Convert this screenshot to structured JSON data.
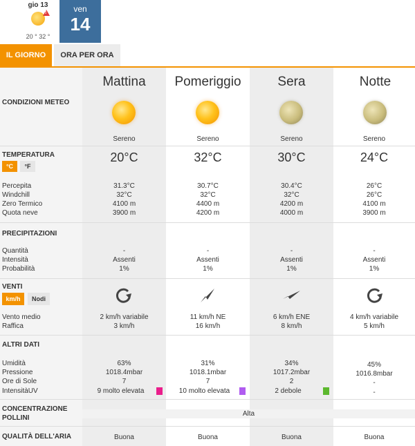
{
  "days": {
    "prev": {
      "label": "gio 13",
      "temps": "20 ° 32 °",
      "icon": "sun-warning-icon"
    },
    "selected": {
      "label": "ven",
      "number": "14"
    }
  },
  "tabs": {
    "day": "IL GIORNO",
    "hourly": "ORA PER ORA"
  },
  "periods": [
    "Mattina",
    "Pomeriggio",
    "Sera",
    "Notte"
  ],
  "sections": {
    "conditions": "CONDIZIONI METEO",
    "temperature": "TEMPERATURA",
    "precipitation": "PRECIPITAZIONI",
    "winds": "VENTI",
    "other": "ALTRI DATI",
    "pollen": "CONCENTRAZIONE POLLINI",
    "air": "QUALITÀ DELL'ARIA"
  },
  "labels": {
    "perceived": "Percepita",
    "windchill": "Windchill",
    "freezing": "Zero Termico",
    "snow": "Quota neve",
    "quantity": "Quantità",
    "intensity": "Intensità",
    "probability": "Probabilità",
    "avg_wind": "Vento medio",
    "gust": "Raffica",
    "humidity": "Umidità",
    "pressure": "Pressione",
    "sun_hours": "Ore di Sole",
    "uv": "IntensitàUV"
  },
  "units": {
    "celsius": "°C",
    "fahrenheit": "°F",
    "kmh": "km/h",
    "knots": "Nodi"
  },
  "conditions": [
    {
      "text": "Sereno",
      "icon": "sun-icon"
    },
    {
      "text": "Sereno",
      "icon": "sun-icon"
    },
    {
      "text": "Sereno",
      "icon": "moon-icon"
    },
    {
      "text": "Sereno",
      "icon": "moon-icon"
    }
  ],
  "temperature": {
    "main": [
      "20°C",
      "32°C",
      "30°C",
      "24°C"
    ],
    "perceived": [
      "31.3°C",
      "30.7°C",
      "30.4°C",
      "26°C"
    ],
    "windchill": [
      "32°C",
      "32°C",
      "32°C",
      "26°C"
    ],
    "freezing": [
      "4100 m",
      "4400 m",
      "4200 m",
      "4100 m"
    ],
    "snow": [
      "3900 m",
      "4200 m",
      "4000 m",
      "3900 m"
    ]
  },
  "precipitation": {
    "quantity": [
      "-",
      "-",
      "-",
      "-"
    ],
    "intensity": [
      "Assenti",
      "Assenti",
      "Assenti",
      "Assenti"
    ],
    "probability": [
      "1%",
      "1%",
      "1%",
      "1%"
    ]
  },
  "wind": {
    "icons": [
      "wind-variable-icon",
      "wind-arrow-ne-icon",
      "wind-arrow-ene-icon",
      "wind-variable-icon"
    ],
    "avg": [
      "2 km/h  variabile",
      "11 km/h NE",
      "6 km/h ENE",
      "4 km/h variabile"
    ],
    "gust": [
      "3 km/h",
      "16 km/h",
      "8 km/h",
      "5 km/h"
    ]
  },
  "other": {
    "humidity": [
      "63%",
      "31%",
      "34%",
      "45%"
    ],
    "pressure": [
      "1018.4mbar",
      "1018.1mbar",
      "1017.2mbar",
      "1016.8mbar"
    ],
    "sun_hours": [
      "7",
      "7",
      "2",
      "-"
    ],
    "uv": [
      "9 molto elevata",
      "10 molto elevata",
      "2 debole",
      "-"
    ],
    "uv_colors": [
      "#ea1e8c",
      "#b05cf0",
      "#5cb82e",
      ""
    ]
  },
  "pollen": "Alta",
  "air": [
    "Buona",
    "Buona",
    "Buona",
    "Buona"
  ],
  "colors": {
    "accent": "#f39200",
    "selected_day": "#3d6e9c"
  }
}
